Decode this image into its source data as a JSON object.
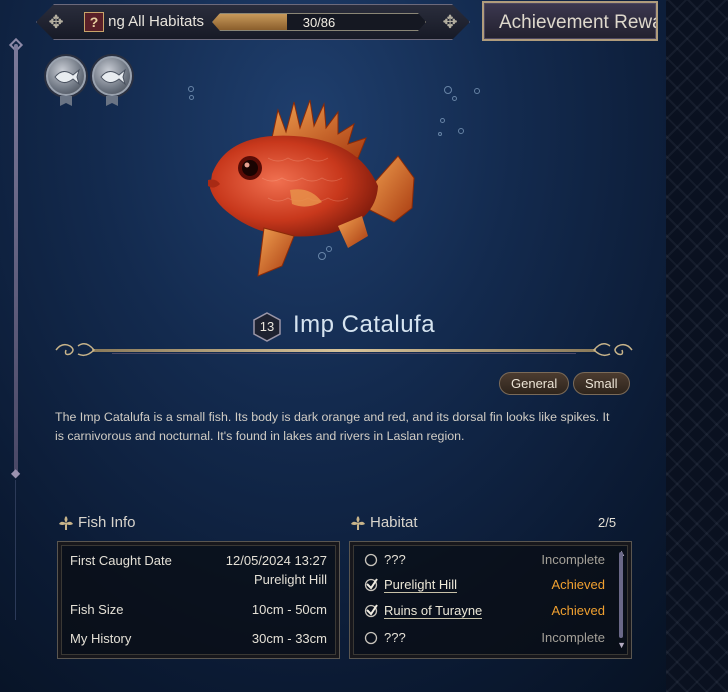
{
  "top_bar": {
    "label": "Finding All Habitats",
    "help_icon": "?",
    "progress_text": "30/86",
    "progress_fraction": 0.349
  },
  "achievement_button": {
    "label": "Achievement Rewards"
  },
  "medals": [
    {
      "icon": "silver-fish-medal-icon"
    },
    {
      "icon": "silver-fish-medal-icon"
    }
  ],
  "fish": {
    "level": "13",
    "name": "Imp Catalufa",
    "tags": [
      "General",
      "Small"
    ],
    "description": "The Imp Catalufa is a small fish. Its body is dark orange and red, and its dorsal fin looks like spikes. It is carnivorous and nocturnal. It's found in lakes and rivers in Laslan region."
  },
  "fish_info": {
    "title": "Fish Info",
    "first_caught_label": "First Caught Date",
    "first_caught_date": "12/05/2024 13:27",
    "first_caught_place": "Purelight Hill",
    "size_label": "Fish Size",
    "size_value": "10cm - 50cm",
    "history_label": "My History",
    "history_value": "30cm - 33cm"
  },
  "habitat": {
    "title": "Habitat",
    "count": "2/5",
    "items": [
      {
        "name": "???",
        "status": "Incomplete",
        "done": false
      },
      {
        "name": "Purelight Hill",
        "status": "Achieved",
        "done": true
      },
      {
        "name": "Ruins of Turayne",
        "status": "Achieved",
        "done": true
      },
      {
        "name": "???",
        "status": "Incomplete",
        "done": false
      }
    ]
  },
  "colors": {
    "achieved": "#f0a030",
    "incomplete": "#a4a098",
    "accent_gold": "#b09c7c"
  }
}
